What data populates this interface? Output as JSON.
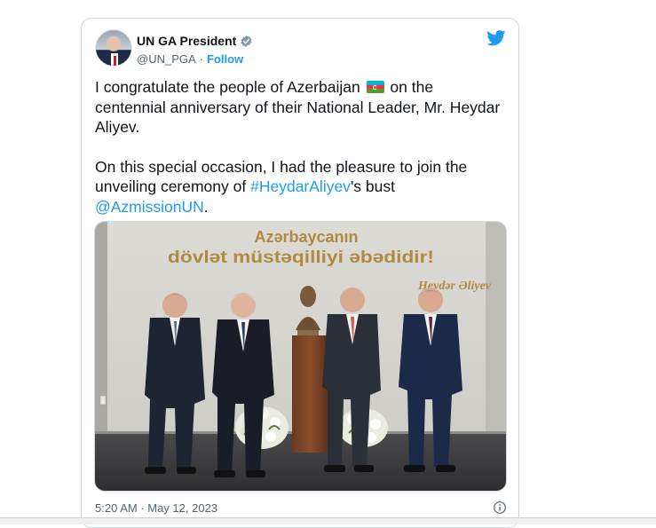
{
  "tweet": {
    "display_name": "UN GA President",
    "handle": "@UN_PGA",
    "separator": "·",
    "follow_label": "Follow",
    "text": {
      "p1_before_flag": "I congratulate the people of Azerbaijan ",
      "p1_after_flag": " on the centennial anniversary of their National Leader, Mr. Heydar Aliyev.",
      "p2_before_tag": "On this special occasion, I had the pleasure to join the unveiling ceremony of ",
      "hashtag": "#HeydarAliyev",
      "p2_after_tag": "'s bust",
      "mention": "@AzmissionUN",
      "p2_end": "."
    },
    "media": {
      "wall_line1": "Azərbaycanın",
      "wall_line2": "dövlət müstəqilliyi əbədidir!",
      "wall_signature": "Heydər Əliyev"
    },
    "timestamp": "5:20 AM · May 12, 2023"
  },
  "icons": {
    "verified": "verified-badge-icon",
    "twitter": "twitter-bird-icon",
    "info": "info-icon",
    "flag": "azerbaijan-flag-icon"
  },
  "colors": {
    "accent": "#1d9bf0",
    "text": "#0f1419",
    "secondary": "#536471",
    "border": "#cfd9de"
  }
}
